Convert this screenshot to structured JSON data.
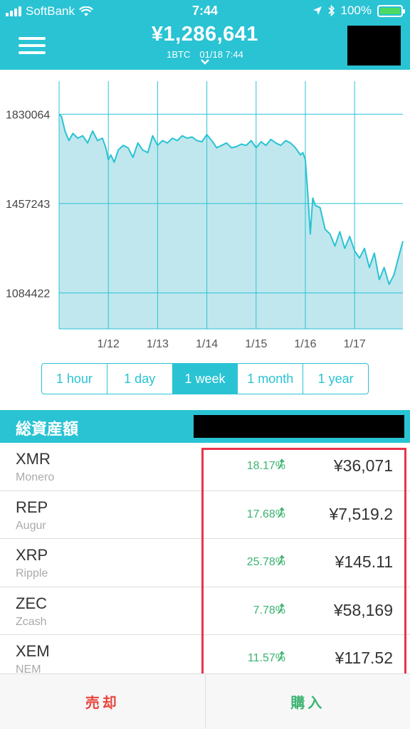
{
  "status_bar": {
    "carrier": "SoftBank",
    "time": "7:44",
    "battery": "100%"
  },
  "header": {
    "price": "¥1,286,641",
    "sub": "1BTC　01/18 7:44",
    "account_masked": true
  },
  "chart_data": {
    "type": "area",
    "x_ticks": [
      "1/12",
      "1/13",
      "1/14",
      "1/15",
      "1/16",
      "1/17"
    ],
    "y_ticks": [
      "1830064",
      "1457243",
      "1084422"
    ],
    "y_tick_values": [
      1830064,
      1457243,
      1084422
    ],
    "ylim": [
      934000,
      1968000
    ],
    "xlim": [
      0,
      6.98
    ],
    "grid": true,
    "color": "#29c3d4",
    "fill": "#c0e7ed",
    "x": [
      0,
      0.05,
      0.12,
      0.2,
      0.28,
      0.38,
      0.48,
      0.58,
      0.68,
      0.78,
      0.88,
      0.95,
      1.0,
      1.05,
      1.12,
      1.2,
      1.3,
      1.4,
      1.5,
      1.6,
      1.7,
      1.8,
      1.9,
      2.0,
      2.1,
      2.2,
      2.3,
      2.4,
      2.5,
      2.6,
      2.7,
      2.8,
      2.9,
      3.0,
      3.1,
      3.2,
      3.3,
      3.4,
      3.5,
      3.6,
      3.7,
      3.8,
      3.9,
      4.0,
      4.1,
      4.2,
      4.3,
      4.4,
      4.5,
      4.6,
      4.7,
      4.8,
      4.9,
      4.95,
      5.0,
      5.05,
      5.1,
      5.15,
      5.2,
      5.3,
      5.4,
      5.5,
      5.6,
      5.7,
      5.8,
      5.9,
      6.0,
      6.1,
      6.2,
      6.3,
      6.4,
      6.5,
      6.6,
      6.7,
      6.8,
      6.9,
      6.98
    ],
    "values": [
      1830000,
      1820000,
      1760000,
      1720000,
      1750000,
      1730000,
      1740000,
      1710000,
      1760000,
      1720000,
      1730000,
      1690000,
      1640000,
      1660000,
      1630000,
      1680000,
      1700000,
      1690000,
      1650000,
      1710000,
      1680000,
      1670000,
      1740000,
      1700000,
      1720000,
      1710000,
      1730000,
      1720000,
      1740000,
      1730000,
      1735000,
      1720000,
      1715000,
      1745000,
      1720000,
      1690000,
      1700000,
      1710000,
      1690000,
      1695000,
      1705000,
      1700000,
      1720000,
      1690000,
      1715000,
      1700000,
      1725000,
      1710000,
      1700000,
      1720000,
      1710000,
      1690000,
      1660000,
      1670000,
      1640000,
      1500000,
      1330000,
      1480000,
      1450000,
      1440000,
      1350000,
      1330000,
      1280000,
      1340000,
      1270000,
      1320000,
      1260000,
      1230000,
      1270000,
      1190000,
      1250000,
      1140000,
      1190000,
      1120000,
      1160000,
      1240000,
      1300000
    ]
  },
  "range_tabs": [
    {
      "label": "1 hour",
      "active": false
    },
    {
      "label": "1 day",
      "active": false
    },
    {
      "label": "1 week",
      "active": true
    },
    {
      "label": "1 month",
      "active": false
    },
    {
      "label": "1 year",
      "active": false
    }
  ],
  "assets": {
    "title": "総資産額",
    "value_masked": true
  },
  "coins": [
    {
      "symbol": "XMR",
      "name": "Monero",
      "change": "18.17%",
      "price": "¥36,071"
    },
    {
      "symbol": "REP",
      "name": "Augur",
      "change": "17.68%",
      "price": "¥7,519.2"
    },
    {
      "symbol": "XRP",
      "name": "Ripple",
      "change": "25.78%",
      "price": "¥145.11"
    },
    {
      "symbol": "ZEC",
      "name": "Zcash",
      "change": "7.78%",
      "price": "¥58,169"
    },
    {
      "symbol": "XEM",
      "name": "NEM",
      "change": "11.57%",
      "price": "¥117.52"
    }
  ],
  "bottom": {
    "sell": "売却",
    "buy": "購入"
  },
  "colors": {
    "accent": "#29c3d4",
    "up": "#3cb371",
    "sell": "#e8453c",
    "highlight": "#e8344c"
  }
}
